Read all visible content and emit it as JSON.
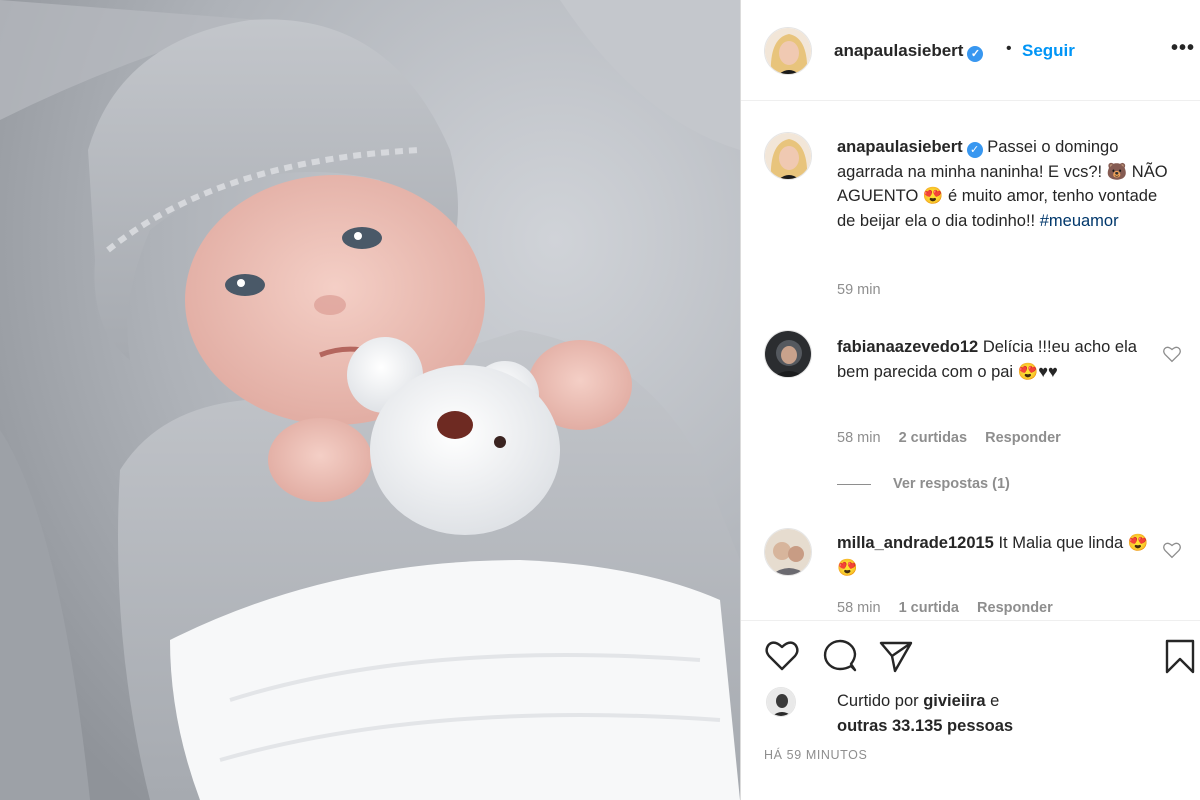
{
  "post": {
    "author": {
      "username": "anapaulasiebert",
      "verified_icon": "verified-badge-icon",
      "follow_separator": "•",
      "follow_label": "Seguir",
      "more_label": "•••"
    },
    "caption": {
      "username": "anapaulasiebert",
      "text": "Passei o domingo agarrada na minha naninha! E vcs?! 🐻 NÃO AGUENTO 😍 é muito amor, tenho vontade de beijar ela o dia todinho!! ",
      "hashtag": "#meuamor",
      "time": "59 min"
    },
    "comments": [
      {
        "username": "fabianaazevedo12",
        "text": "Delícia !!!eu acho ela bem parecida com o pai 😍♥♥",
        "time": "58 min",
        "likes": "2 curtidas",
        "reply_label": "Responder",
        "view_replies": "Ver respostas (1)"
      },
      {
        "username": "milla_andrade12015",
        "text": "It Malia que linda 😍😍",
        "time": "58 min",
        "likes": "1 curtida",
        "reply_label": "Responder"
      }
    ],
    "actions": {
      "icons": [
        "heart-icon",
        "comment-icon",
        "share-icon",
        "bookmark-icon"
      ]
    },
    "likes": {
      "prefix": "Curtido por ",
      "liked_by_user": "givieiira",
      "connector": " e",
      "others": "outras 33.135 pessoas"
    },
    "timestamp": "HÁ 59 MINUTOS",
    "colors": {
      "link_blue": "#0095f6",
      "verified_blue": "#3897f0",
      "hashtag_blue": "#00376b",
      "muted_gray": "#8e8e8e",
      "text_dark": "#262626"
    }
  }
}
